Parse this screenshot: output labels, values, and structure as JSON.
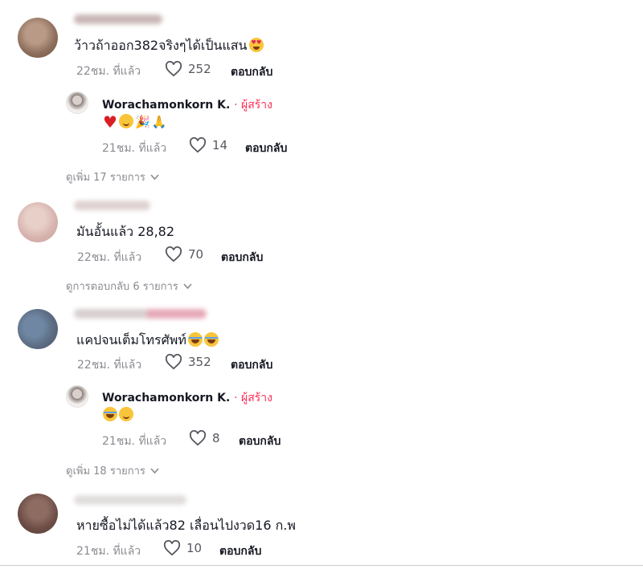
{
  "comments": [
    {
      "text": "ว้าวถ้าออก382จริงๆได้เป็นแสน",
      "time": "22ชม. ที่แล้ว",
      "likes": "252",
      "reply_label": "ตอบกลับ",
      "reply": {
        "author": "Worachamonkorn K.",
        "creator_tag": "· ผู้สร้าง",
        "time": "21ชม. ที่แล้ว",
        "likes": "14",
        "reply_label": "ตอบกลับ"
      },
      "more_label": "ดูเพิ่ม 17 รายการ"
    },
    {
      "text": "มันอั้นแล้ว 28,82",
      "time": "22ชม. ที่แล้ว",
      "likes": "70",
      "reply_label": "ตอบกลับ",
      "more_label": "ดูการตอบกลับ 6 รายการ"
    },
    {
      "text": "แคปจนเต็มโทรศัพท์",
      "time": "22ชม. ที่แล้ว",
      "likes": "352",
      "reply_label": "ตอบกลับ",
      "reply": {
        "author": "Worachamonkorn K.",
        "creator_tag": "· ผู้สร้าง",
        "time": "21ชม. ที่แล้ว",
        "likes": "8",
        "reply_label": "ตอบกลับ"
      },
      "more_label": "ดูเพิ่ม 18 รายการ"
    },
    {
      "text": "หายซื้อไม่ได้แล้ว82 เลื่อนไปงวด16 ก.พ",
      "time": "21ชม. ที่แล้ว",
      "likes": "10",
      "reply_label": "ตอบกลับ"
    }
  ],
  "icons": {
    "like": "heart-outline-icon",
    "expand": "chevron-down-icon"
  },
  "colors": {
    "creator_accent": "#fe2c55",
    "meta_gray": "#8a8b91",
    "text_dark": "#161823"
  }
}
